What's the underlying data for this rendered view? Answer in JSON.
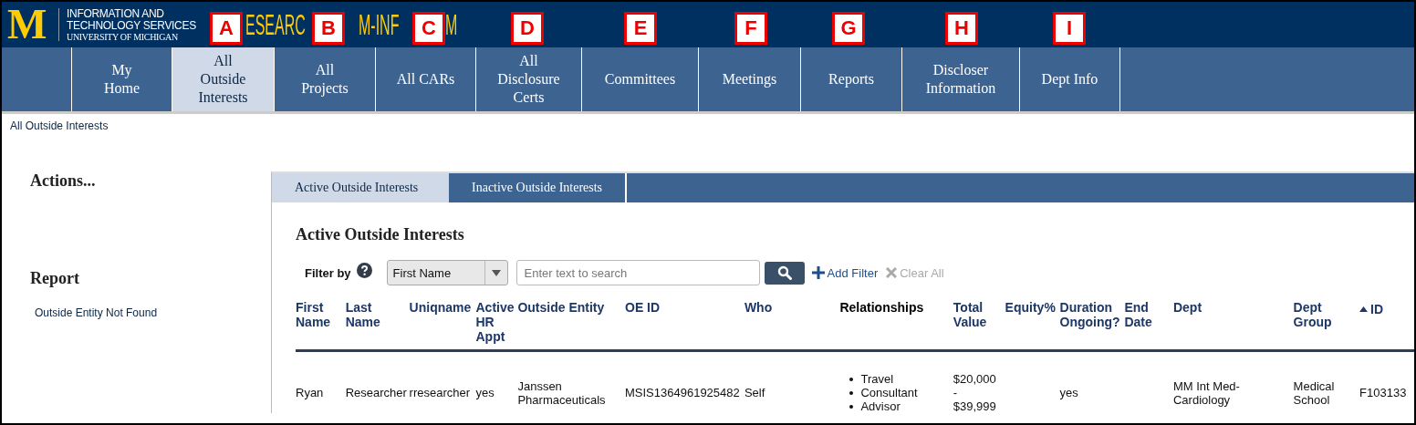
{
  "header": {
    "logo": "M",
    "org_lines": [
      "INFORMATION AND",
      "TECHNOLOGY SERVICES",
      "UNIVERSITY OF MICHIGAN"
    ],
    "title_fragments": [
      "ESEARC",
      "M-INF",
      "M"
    ]
  },
  "markers": [
    "A",
    "B",
    "C",
    "D",
    "E",
    "F",
    "G",
    "H",
    "I"
  ],
  "nav": [
    {
      "label": "My\nHome",
      "selected": false
    },
    {
      "label": "All\nOutside\nInterests",
      "selected": true
    },
    {
      "label": "All\nProjects",
      "selected": false
    },
    {
      "label": "All CARs",
      "selected": false
    },
    {
      "label": "All\nDisclosure\nCerts",
      "selected": false
    },
    {
      "label": "Committees",
      "selected": false
    },
    {
      "label": "Meetings",
      "selected": false
    },
    {
      "label": "Reports",
      "selected": false
    },
    {
      "label": "Discloser\nInformation",
      "selected": false
    },
    {
      "label": "Dept Info",
      "selected": false
    }
  ],
  "breadcrumb": "All Outside Interests",
  "sidebar": {
    "actions_title": "Actions...",
    "report_title": "Report",
    "report_links": [
      "Outside Entity Not Found"
    ]
  },
  "tabs": [
    {
      "label": "Active Outside Interests",
      "selected": true
    },
    {
      "label": "Inactive Outside Interests",
      "selected": false
    }
  ],
  "heading": "Active Outside Interests",
  "filter": {
    "label": "Filter by",
    "field": "First Name",
    "placeholder": "Enter text to search",
    "add_filter": "Add Filter",
    "clear_all": "Clear All",
    "clear_disabled": true
  },
  "table": {
    "columns": [
      {
        "label": "First Name",
        "sortable": true,
        "sorted": false
      },
      {
        "label": "Last Name",
        "sortable": true,
        "sorted": false
      },
      {
        "label": "Uniqname",
        "sortable": true,
        "sorted": false
      },
      {
        "label": "Active HR Appt",
        "sortable": true,
        "sorted": false
      },
      {
        "label": "Outside Entity",
        "sortable": true,
        "sorted": false
      },
      {
        "label": "OE ID",
        "sortable": true,
        "sorted": false
      },
      {
        "label": "Who",
        "sortable": true,
        "sorted": false
      },
      {
        "label": "Relationships",
        "sortable": false,
        "sorted": false
      },
      {
        "label": "Total Value",
        "sortable": true,
        "sorted": false
      },
      {
        "label": "Equity%",
        "sortable": true,
        "sorted": false
      },
      {
        "label": "Duration Ongoing?",
        "sortable": true,
        "sorted": false
      },
      {
        "label": "End Date",
        "sortable": true,
        "sorted": false
      },
      {
        "label": "Dept",
        "sortable": true,
        "sorted": false
      },
      {
        "label": "Dept Group",
        "sortable": true,
        "sorted": false
      },
      {
        "label": "ID",
        "sortable": true,
        "sorted": true
      }
    ],
    "rows": [
      {
        "cells": [
          "Ryan",
          "Researcher",
          "rresearcher",
          "yes",
          "Janssen Pharmaceuticals",
          "MSIS1364961925482",
          "Self",
          [
            "Travel",
            "Consultant",
            "Advisor"
          ],
          "$20,000\n-\n$39,999",
          "",
          "yes",
          "",
          "MM Int Med-\nCardiology",
          "Medical\nSchool",
          "F103133"
        ]
      }
    ]
  }
}
